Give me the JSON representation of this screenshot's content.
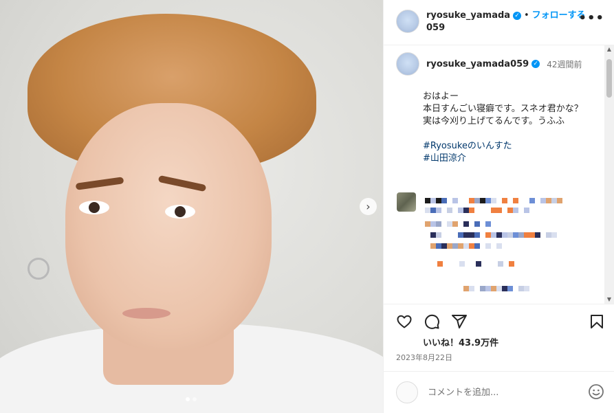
{
  "post": {
    "username": "ryosuke_yamada059",
    "verified_mark": "✓",
    "follow_label": "フォローする",
    "separator": "•",
    "time_ago": "42週間前",
    "caption_lines": [
      "おはよー",
      "本日すんごい寝癖です。スネオ君かな？",
      "実は今刈り上げてるんです。うふふ",
      "",
      "#Ryosukeのいんすた",
      "#山田涼介"
    ],
    "likes": "いいね！43.9万件",
    "date": "2023年8月22日",
    "comment_placeholder": "コメントを追加...",
    "more_label": "•••",
    "next_label": "›",
    "carousel": {
      "count": 2,
      "active": 0
    }
  },
  "icons": {
    "like": "heart-icon",
    "comment": "comment-icon",
    "share": "share-icon",
    "save": "bookmark-icon",
    "emoji": "smiley-icon",
    "next": "chevron-right-icon",
    "more": "more-icon"
  },
  "colors": {
    "accent": "#0095f6",
    "hashtag": "#00376b",
    "muted": "#737373"
  }
}
